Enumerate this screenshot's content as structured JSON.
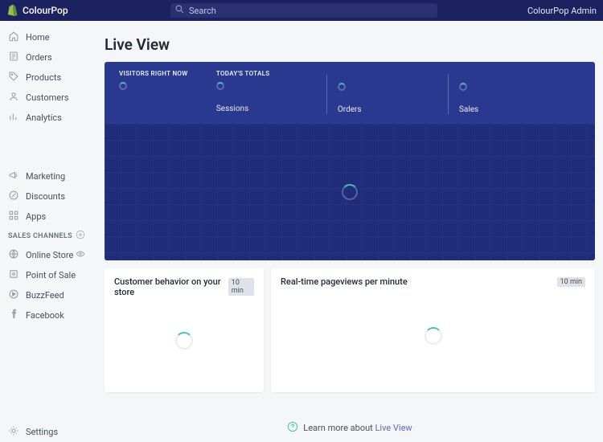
{
  "topbar": {
    "brand": "ColourPop",
    "search_placeholder": "Search",
    "admin_label": "ColourPop Admin"
  },
  "sidebar": {
    "primary": [
      {
        "key": "home",
        "label": "Home"
      },
      {
        "key": "orders",
        "label": "Orders"
      },
      {
        "key": "products",
        "label": "Products"
      },
      {
        "key": "customers",
        "label": "Customers"
      },
      {
        "key": "analytics",
        "label": "Analytics"
      }
    ],
    "secondary": [
      {
        "key": "marketing",
        "label": "Marketing"
      },
      {
        "key": "discounts",
        "label": "Discounts"
      },
      {
        "key": "apps",
        "label": "Apps"
      }
    ],
    "channels_header": "SALES CHANNELS",
    "channels": [
      {
        "key": "online-store",
        "label": "Online Store"
      },
      {
        "key": "pos",
        "label": "Point of Sale"
      },
      {
        "key": "buzzfeed",
        "label": "BuzzFeed"
      },
      {
        "key": "facebook",
        "label": "Facebook"
      }
    ],
    "settings_label": "Settings"
  },
  "page": {
    "title": "Live View",
    "hero": {
      "visitors_label": "VISITORS RIGHT NOW",
      "totals_label": "TODAY'S TOTALS",
      "sessions_label": "Sessions",
      "orders_label": "Orders",
      "sales_label": "Sales"
    },
    "cards": {
      "behavior_title": "Customer behavior on your store",
      "behavior_badge": "10 min",
      "pageviews_title": "Real-time pageviews per minute",
      "pageviews_badge": "10 min"
    },
    "footer": {
      "prefix": "Learn more about ",
      "link": "Live View"
    }
  }
}
